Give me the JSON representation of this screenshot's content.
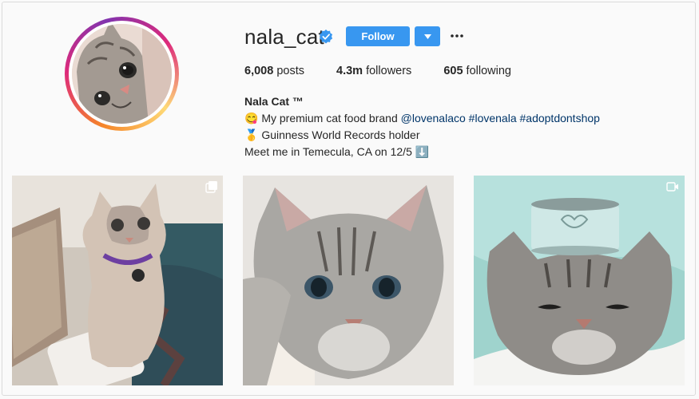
{
  "profile": {
    "username": "nala_cat",
    "follow_label": "Follow",
    "more_label": "•••",
    "stats": {
      "posts_count": "6,008",
      "posts_label": "posts",
      "followers_count": "4.3m",
      "followers_label": "followers",
      "following_count": "605",
      "following_label": "following"
    },
    "bio": {
      "name": "Nala Cat ™",
      "line1_emoji": "😋",
      "line1_text": "My premium cat food brand",
      "line1_links": [
        "@lovenalaco",
        "#lovenala",
        "#adoptdontshop"
      ],
      "line2_emoji": "🥇",
      "line2_text": "Guinness World Records holder",
      "line3_text": "Meet me in Temecula, CA on 12/5",
      "line3_emoji": "⬇️"
    }
  },
  "posts": [
    {
      "badge_icon": "carousel-icon"
    },
    {
      "badge_icon": ""
    },
    {
      "badge_icon": "video-icon"
    }
  ],
  "colors": {
    "accent": "#3897f0",
    "link": "#003569",
    "verified": "#3897f0"
  }
}
